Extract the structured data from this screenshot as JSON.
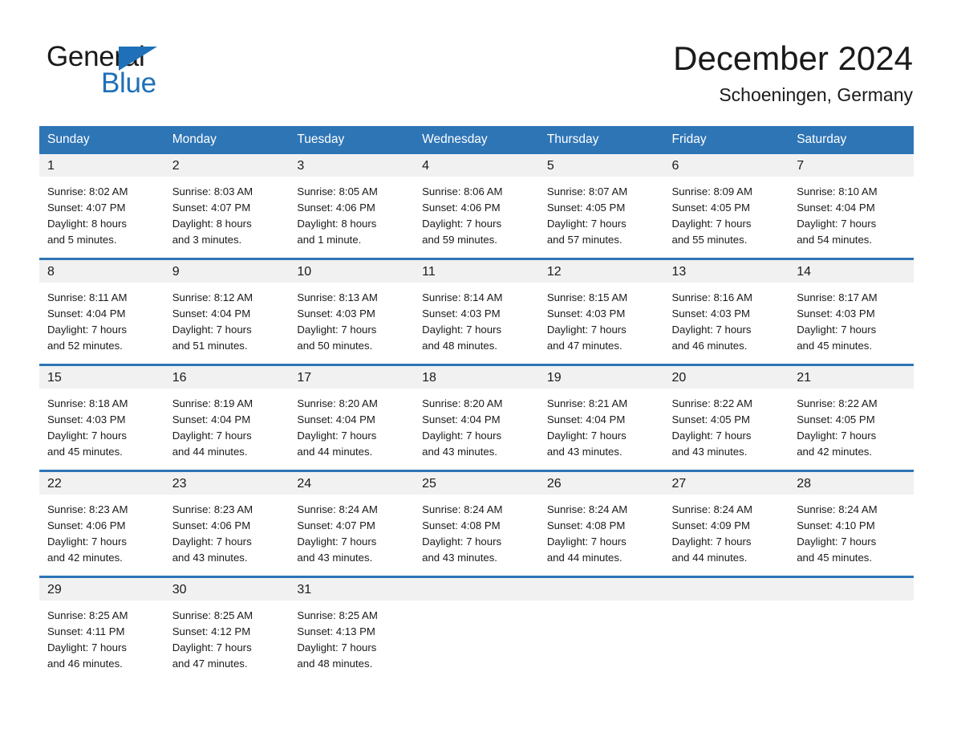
{
  "brand": {
    "name_part1": "General",
    "name_part2": "Blue",
    "accent_color": "#1F70B8"
  },
  "header": {
    "month_title": "December 2024",
    "location": "Schoeningen, Germany"
  },
  "colors": {
    "header_row": "#2E75B6",
    "day_strip": "#F1F1F1",
    "text": "#1a1a1a"
  },
  "calendar": {
    "weekday_headers": [
      "Sunday",
      "Monday",
      "Tuesday",
      "Wednesday",
      "Thursday",
      "Friday",
      "Saturday"
    ],
    "weeks": [
      [
        {
          "day": "1",
          "sunrise": "Sunrise: 8:02 AM",
          "sunset": "Sunset: 4:07 PM",
          "daylight_line1": "Daylight: 8 hours",
          "daylight_line2": "and 5 minutes."
        },
        {
          "day": "2",
          "sunrise": "Sunrise: 8:03 AM",
          "sunset": "Sunset: 4:07 PM",
          "daylight_line1": "Daylight: 8 hours",
          "daylight_line2": "and 3 minutes."
        },
        {
          "day": "3",
          "sunrise": "Sunrise: 8:05 AM",
          "sunset": "Sunset: 4:06 PM",
          "daylight_line1": "Daylight: 8 hours",
          "daylight_line2": "and 1 minute."
        },
        {
          "day": "4",
          "sunrise": "Sunrise: 8:06 AM",
          "sunset": "Sunset: 4:06 PM",
          "daylight_line1": "Daylight: 7 hours",
          "daylight_line2": "and 59 minutes."
        },
        {
          "day": "5",
          "sunrise": "Sunrise: 8:07 AM",
          "sunset": "Sunset: 4:05 PM",
          "daylight_line1": "Daylight: 7 hours",
          "daylight_line2": "and 57 minutes."
        },
        {
          "day": "6",
          "sunrise": "Sunrise: 8:09 AM",
          "sunset": "Sunset: 4:05 PM",
          "daylight_line1": "Daylight: 7 hours",
          "daylight_line2": "and 55 minutes."
        },
        {
          "day": "7",
          "sunrise": "Sunrise: 8:10 AM",
          "sunset": "Sunset: 4:04 PM",
          "daylight_line1": "Daylight: 7 hours",
          "daylight_line2": "and 54 minutes."
        }
      ],
      [
        {
          "day": "8",
          "sunrise": "Sunrise: 8:11 AM",
          "sunset": "Sunset: 4:04 PM",
          "daylight_line1": "Daylight: 7 hours",
          "daylight_line2": "and 52 minutes."
        },
        {
          "day": "9",
          "sunrise": "Sunrise: 8:12 AM",
          "sunset": "Sunset: 4:04 PM",
          "daylight_line1": "Daylight: 7 hours",
          "daylight_line2": "and 51 minutes."
        },
        {
          "day": "10",
          "sunrise": "Sunrise: 8:13 AM",
          "sunset": "Sunset: 4:03 PM",
          "daylight_line1": "Daylight: 7 hours",
          "daylight_line2": "and 50 minutes."
        },
        {
          "day": "11",
          "sunrise": "Sunrise: 8:14 AM",
          "sunset": "Sunset: 4:03 PM",
          "daylight_line1": "Daylight: 7 hours",
          "daylight_line2": "and 48 minutes."
        },
        {
          "day": "12",
          "sunrise": "Sunrise: 8:15 AM",
          "sunset": "Sunset: 4:03 PM",
          "daylight_line1": "Daylight: 7 hours",
          "daylight_line2": "and 47 minutes."
        },
        {
          "day": "13",
          "sunrise": "Sunrise: 8:16 AM",
          "sunset": "Sunset: 4:03 PM",
          "daylight_line1": "Daylight: 7 hours",
          "daylight_line2": "and 46 minutes."
        },
        {
          "day": "14",
          "sunrise": "Sunrise: 8:17 AM",
          "sunset": "Sunset: 4:03 PM",
          "daylight_line1": "Daylight: 7 hours",
          "daylight_line2": "and 45 minutes."
        }
      ],
      [
        {
          "day": "15",
          "sunrise": "Sunrise: 8:18 AM",
          "sunset": "Sunset: 4:03 PM",
          "daylight_line1": "Daylight: 7 hours",
          "daylight_line2": "and 45 minutes."
        },
        {
          "day": "16",
          "sunrise": "Sunrise: 8:19 AM",
          "sunset": "Sunset: 4:04 PM",
          "daylight_line1": "Daylight: 7 hours",
          "daylight_line2": "and 44 minutes."
        },
        {
          "day": "17",
          "sunrise": "Sunrise: 8:20 AM",
          "sunset": "Sunset: 4:04 PM",
          "daylight_line1": "Daylight: 7 hours",
          "daylight_line2": "and 44 minutes."
        },
        {
          "day": "18",
          "sunrise": "Sunrise: 8:20 AM",
          "sunset": "Sunset: 4:04 PM",
          "daylight_line1": "Daylight: 7 hours",
          "daylight_line2": "and 43 minutes."
        },
        {
          "day": "19",
          "sunrise": "Sunrise: 8:21 AM",
          "sunset": "Sunset: 4:04 PM",
          "daylight_line1": "Daylight: 7 hours",
          "daylight_line2": "and 43 minutes."
        },
        {
          "day": "20",
          "sunrise": "Sunrise: 8:22 AM",
          "sunset": "Sunset: 4:05 PM",
          "daylight_line1": "Daylight: 7 hours",
          "daylight_line2": "and 43 minutes."
        },
        {
          "day": "21",
          "sunrise": "Sunrise: 8:22 AM",
          "sunset": "Sunset: 4:05 PM",
          "daylight_line1": "Daylight: 7 hours",
          "daylight_line2": "and 42 minutes."
        }
      ],
      [
        {
          "day": "22",
          "sunrise": "Sunrise: 8:23 AM",
          "sunset": "Sunset: 4:06 PM",
          "daylight_line1": "Daylight: 7 hours",
          "daylight_line2": "and 42 minutes."
        },
        {
          "day": "23",
          "sunrise": "Sunrise: 8:23 AM",
          "sunset": "Sunset: 4:06 PM",
          "daylight_line1": "Daylight: 7 hours",
          "daylight_line2": "and 43 minutes."
        },
        {
          "day": "24",
          "sunrise": "Sunrise: 8:24 AM",
          "sunset": "Sunset: 4:07 PM",
          "daylight_line1": "Daylight: 7 hours",
          "daylight_line2": "and 43 minutes."
        },
        {
          "day": "25",
          "sunrise": "Sunrise: 8:24 AM",
          "sunset": "Sunset: 4:08 PM",
          "daylight_line1": "Daylight: 7 hours",
          "daylight_line2": "and 43 minutes."
        },
        {
          "day": "26",
          "sunrise": "Sunrise: 8:24 AM",
          "sunset": "Sunset: 4:08 PM",
          "daylight_line1": "Daylight: 7 hours",
          "daylight_line2": "and 44 minutes."
        },
        {
          "day": "27",
          "sunrise": "Sunrise: 8:24 AM",
          "sunset": "Sunset: 4:09 PM",
          "daylight_line1": "Daylight: 7 hours",
          "daylight_line2": "and 44 minutes."
        },
        {
          "day": "28",
          "sunrise": "Sunrise: 8:24 AM",
          "sunset": "Sunset: 4:10 PM",
          "daylight_line1": "Daylight: 7 hours",
          "daylight_line2": "and 45 minutes."
        }
      ],
      [
        {
          "day": "29",
          "sunrise": "Sunrise: 8:25 AM",
          "sunset": "Sunset: 4:11 PM",
          "daylight_line1": "Daylight: 7 hours",
          "daylight_line2": "and 46 minutes."
        },
        {
          "day": "30",
          "sunrise": "Sunrise: 8:25 AM",
          "sunset": "Sunset: 4:12 PM",
          "daylight_line1": "Daylight: 7 hours",
          "daylight_line2": "and 47 minutes."
        },
        {
          "day": "31",
          "sunrise": "Sunrise: 8:25 AM",
          "sunset": "Sunset: 4:13 PM",
          "daylight_line1": "Daylight: 7 hours",
          "daylight_line2": "and 48 minutes."
        },
        {
          "day": "",
          "sunrise": "",
          "sunset": "",
          "daylight_line1": "",
          "daylight_line2": ""
        },
        {
          "day": "",
          "sunrise": "",
          "sunset": "",
          "daylight_line1": "",
          "daylight_line2": ""
        },
        {
          "day": "",
          "sunrise": "",
          "sunset": "",
          "daylight_line1": "",
          "daylight_line2": ""
        },
        {
          "day": "",
          "sunrise": "",
          "sunset": "",
          "daylight_line1": "",
          "daylight_line2": ""
        }
      ]
    ]
  }
}
